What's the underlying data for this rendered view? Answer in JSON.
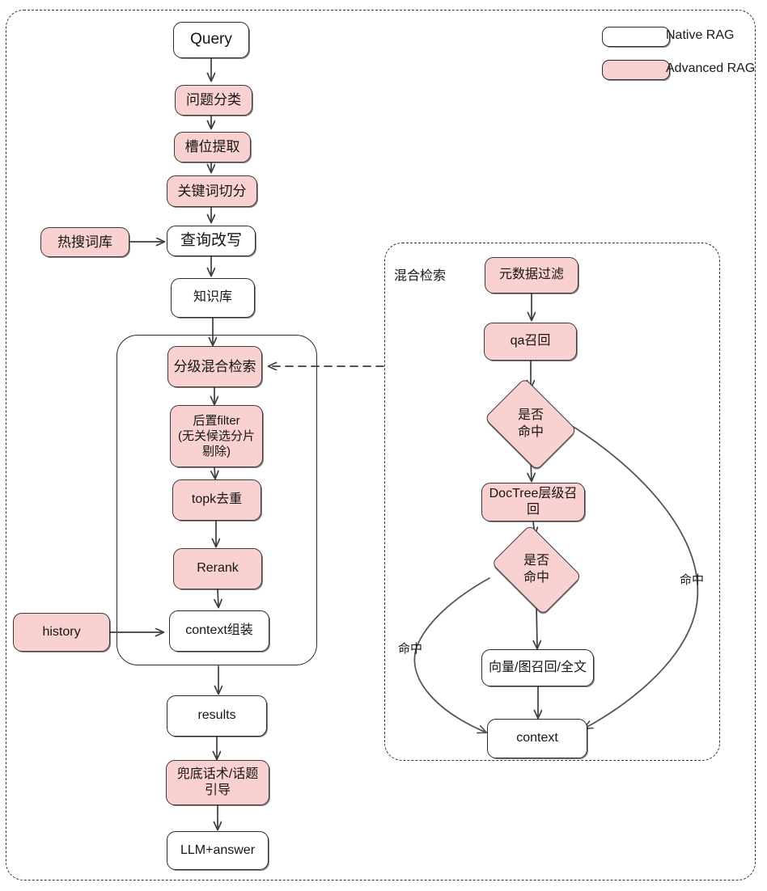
{
  "diagram": {
    "title_alt": "RAG pipeline flowchart",
    "colors": {
      "pink_fill": "#fad1d1",
      "node_stroke": "#2b2b2b",
      "edge_stroke": "#4a4a4a",
      "white_fill": "#ffffff",
      "dashed_stroke": "#333333"
    }
  },
  "legend": {
    "items": [
      {
        "label": "Native RAG",
        "style": "white"
      },
      {
        "label": "Advanced RAG",
        "style": "pink"
      }
    ]
  },
  "left_flow": {
    "frame_label": "",
    "nodes": [
      {
        "id": "query",
        "label": "Query",
        "style": "white"
      },
      {
        "id": "intent",
        "label": "问题分类",
        "style": "pink"
      },
      {
        "id": "slot",
        "label": "槽位提取",
        "style": "pink"
      },
      {
        "id": "keyword",
        "label": "关键词切分",
        "style": "pink"
      },
      {
        "id": "hotwords",
        "label": "热搜词库",
        "style": "pink"
      },
      {
        "id": "rewrite",
        "label": "查询改写",
        "style": "white"
      },
      {
        "id": "kb",
        "label": "知识库",
        "style": "white"
      },
      {
        "id": "hybrid",
        "label": "分级混合检索",
        "style": "pink"
      },
      {
        "id": "postfilter",
        "label": "后置filter\n(无关候选分片\n剔除)",
        "style": "pink"
      },
      {
        "id": "topk",
        "label": "topk去重",
        "style": "pink"
      },
      {
        "id": "rerank",
        "label": "Rerank",
        "style": "pink"
      },
      {
        "id": "history",
        "label": "history",
        "style": "pink"
      },
      {
        "id": "ctxassemble",
        "label": "context组装",
        "style": "white"
      },
      {
        "id": "results",
        "label": "results",
        "style": "white"
      },
      {
        "id": "fallback",
        "label": "兜底话术/话题\n引导",
        "style": "pink"
      },
      {
        "id": "llm",
        "label": "LLM+answer",
        "style": "white"
      }
    ]
  },
  "right_flow": {
    "frame_label": "混合检索",
    "nodes": [
      {
        "id": "metafilter",
        "label": "元数据过滤",
        "style": "pink",
        "shape": "box"
      },
      {
        "id": "qarecall",
        "label": "qa召回",
        "style": "pink",
        "shape": "box"
      },
      {
        "id": "hit1",
        "label": "是否\n命中",
        "style": "pink",
        "shape": "diamond"
      },
      {
        "id": "doctree",
        "label": "DocTree层级召回",
        "style": "pink",
        "shape": "box"
      },
      {
        "id": "hit2",
        "label": "是否\n命中",
        "style": "pink",
        "shape": "diamond"
      },
      {
        "id": "vectorrecall",
        "label": "向量/图召回/全文",
        "style": "white",
        "shape": "box"
      },
      {
        "id": "context",
        "label": "context",
        "style": "white",
        "shape": "box"
      }
    ],
    "edge_labels": [
      {
        "id": "hit-left",
        "label": "命中"
      },
      {
        "id": "hit-right",
        "label": "命中"
      }
    ]
  }
}
